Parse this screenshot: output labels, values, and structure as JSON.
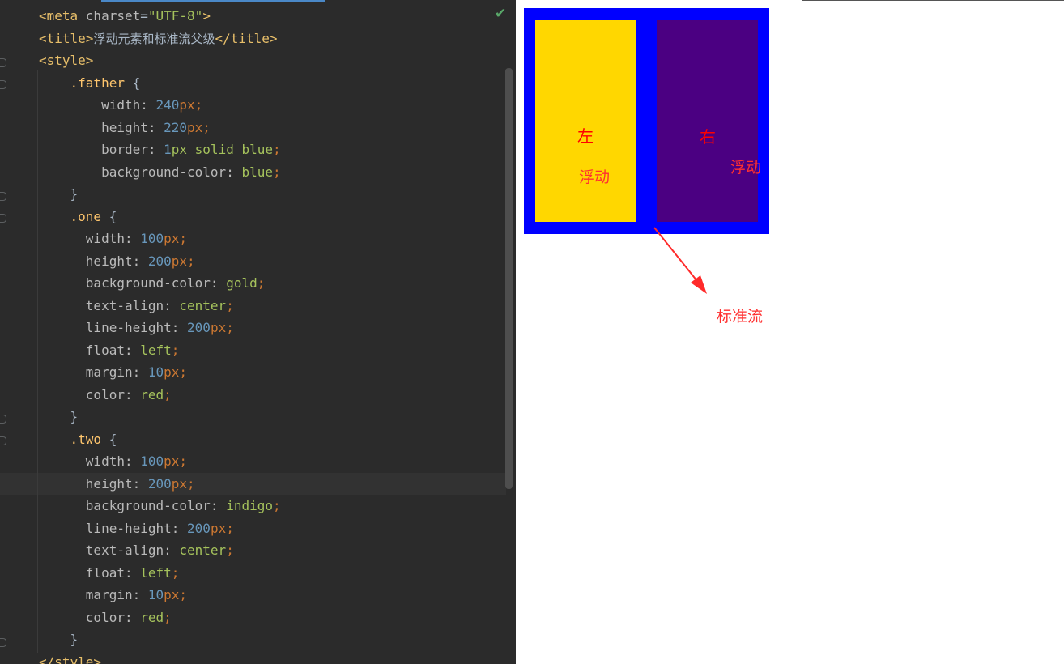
{
  "editor": {
    "lines": [
      {
        "parts": [
          [
            "tag",
            "<meta "
          ],
          [
            "attr",
            "charset"
          ],
          [
            "brace",
            "="
          ],
          [
            "str",
            "\"UTF-8\""
          ],
          [
            "tag",
            ">"
          ]
        ]
      },
      {
        "parts": [
          [
            "tag",
            "<title>"
          ],
          [
            "zh",
            "浮动元素和标准流父级"
          ],
          [
            "tag",
            "</title>"
          ]
        ]
      },
      {
        "parts": [
          [
            "tag",
            "<style>"
          ]
        ]
      },
      {
        "parts": [
          [
            "sel",
            "    .father "
          ],
          [
            "brace",
            "{"
          ]
        ]
      },
      {
        "parts": [
          [
            "prop",
            "        width: "
          ],
          [
            "num",
            "240"
          ],
          [
            "unit",
            "px"
          ],
          [
            "punc",
            ";"
          ]
        ]
      },
      {
        "parts": [
          [
            "prop",
            "        height: "
          ],
          [
            "num",
            "220"
          ],
          [
            "unit",
            "px"
          ],
          [
            "punc",
            ";"
          ]
        ]
      },
      {
        "parts": [
          [
            "prop",
            "        border: "
          ],
          [
            "num",
            "1"
          ],
          [
            "kw",
            "px solid blue"
          ],
          [
            "punc",
            ";"
          ]
        ]
      },
      {
        "parts": [
          [
            "prop",
            "        background-color: "
          ],
          [
            "kw",
            "blue"
          ],
          [
            "punc",
            ";"
          ]
        ]
      },
      {
        "parts": [
          [
            "brace",
            "    }"
          ]
        ]
      },
      {
        "parts": [
          [
            "sel",
            "    .one "
          ],
          [
            "brace",
            "{"
          ]
        ]
      },
      {
        "parts": [
          [
            "prop",
            "      width: "
          ],
          [
            "num",
            "100"
          ],
          [
            "unit",
            "px"
          ],
          [
            "punc",
            ";"
          ]
        ]
      },
      {
        "parts": [
          [
            "prop",
            "      height: "
          ],
          [
            "num",
            "200"
          ],
          [
            "unit",
            "px"
          ],
          [
            "punc",
            ";"
          ]
        ]
      },
      {
        "parts": [
          [
            "prop",
            "      background-color: "
          ],
          [
            "kw",
            "gold"
          ],
          [
            "punc",
            ";"
          ]
        ]
      },
      {
        "parts": [
          [
            "prop",
            "      text-align: "
          ],
          [
            "kw",
            "center"
          ],
          [
            "punc",
            ";"
          ]
        ]
      },
      {
        "parts": [
          [
            "prop",
            "      line-height: "
          ],
          [
            "num",
            "200"
          ],
          [
            "unit",
            "px"
          ],
          [
            "punc",
            ";"
          ]
        ]
      },
      {
        "parts": [
          [
            "prop",
            "      float: "
          ],
          [
            "kw",
            "left"
          ],
          [
            "punc",
            ";"
          ]
        ]
      },
      {
        "parts": [
          [
            "prop",
            "      margin: "
          ],
          [
            "num",
            "10"
          ],
          [
            "unit",
            "px"
          ],
          [
            "punc",
            ";"
          ]
        ]
      },
      {
        "parts": [
          [
            "prop",
            "      color: "
          ],
          [
            "kw",
            "red"
          ],
          [
            "punc",
            ";"
          ]
        ]
      },
      {
        "parts": [
          [
            "brace",
            "    }"
          ]
        ]
      },
      {
        "parts": [
          [
            "sel",
            "    .two "
          ],
          [
            "brace",
            "{"
          ]
        ]
      },
      {
        "parts": [
          [
            "prop",
            "      width: "
          ],
          [
            "num",
            "100"
          ],
          [
            "unit",
            "px"
          ],
          [
            "punc",
            ";"
          ]
        ]
      },
      {
        "parts": [
          [
            "prop",
            "      height: "
          ],
          [
            "num",
            "200"
          ],
          [
            "unit",
            "px"
          ],
          [
            "punc",
            ";"
          ]
        ]
      },
      {
        "parts": [
          [
            "prop",
            "      background-color: "
          ],
          [
            "kw",
            "indigo"
          ],
          [
            "punc",
            ";"
          ]
        ]
      },
      {
        "parts": [
          [
            "prop",
            "      line-height: "
          ],
          [
            "num",
            "200"
          ],
          [
            "unit",
            "px"
          ],
          [
            "punc",
            ";"
          ]
        ]
      },
      {
        "parts": [
          [
            "prop",
            "      text-align: "
          ],
          [
            "kw",
            "center"
          ],
          [
            "punc",
            ";"
          ]
        ]
      },
      {
        "parts": [
          [
            "prop",
            "      float: "
          ],
          [
            "kw",
            "left"
          ],
          [
            "punc",
            ";"
          ]
        ]
      },
      {
        "parts": [
          [
            "prop",
            "      margin: "
          ],
          [
            "num",
            "10"
          ],
          [
            "unit",
            "px"
          ],
          [
            "punc",
            ";"
          ]
        ]
      },
      {
        "parts": [
          [
            "prop",
            "      color: "
          ],
          [
            "kw",
            "red"
          ],
          [
            "punc",
            ";"
          ]
        ]
      },
      {
        "parts": [
          [
            "brace",
            "    }"
          ]
        ]
      },
      {
        "parts": [
          [
            "tag",
            "</style>"
          ]
        ]
      }
    ],
    "status_icon": "check-icon",
    "status_glyph": "✔"
  },
  "preview": {
    "box_one_label": "左",
    "box_two_label": "右",
    "float_label_one": "浮动",
    "float_label_two": "浮动",
    "standard_flow_label": "标准流",
    "colors": {
      "father": "#0000ff",
      "one": "#ffd700",
      "two": "#4b0082",
      "text": "#ff0000",
      "annotation": "#ff3030"
    }
  }
}
